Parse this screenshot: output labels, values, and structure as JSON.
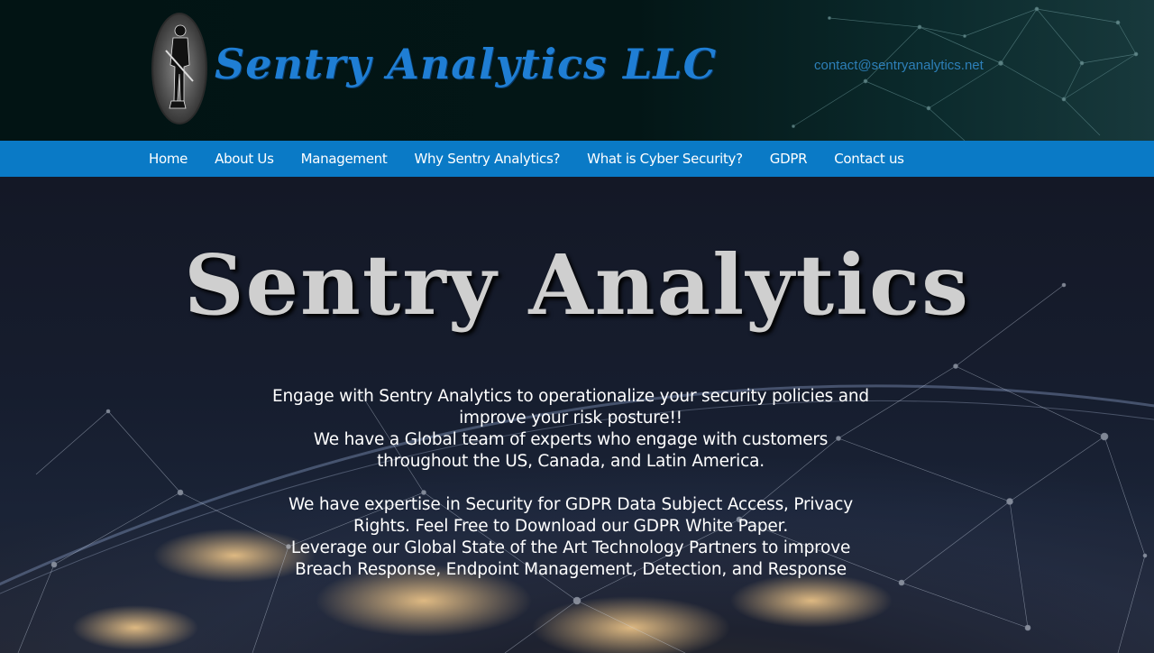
{
  "header": {
    "brand_name": "Sentry Analytics LLC",
    "contact_email": "contact@sentryanalytics.net"
  },
  "nav": {
    "items": [
      {
        "label": "Home"
      },
      {
        "label": "About Us"
      },
      {
        "label": "Management"
      },
      {
        "label": "Why Sentry Analytics?"
      },
      {
        "label": "What is Cyber Security?"
      },
      {
        "label": "GDPR"
      },
      {
        "label": "Contact us"
      }
    ]
  },
  "hero": {
    "title": "Sentry Analytics",
    "lines": [
      "Engage with Sentry Analytics to operationalize your security policies and",
      "improve your risk posture!!",
      "We have a Global team of experts who engage with customers",
      "throughout the US, Canada, and Latin America.",
      "We have expertise in Security for GDPR Data Subject Access, Privacy",
      "Rights. Feel Free to Download our GDPR White Paper.",
      "Leverage our Global State of the Art Technology Partners to improve",
      "Breach Response, Endpoint Management,  Detection, and Response"
    ]
  },
  "colors": {
    "brand": "#1f7ed4",
    "nav_bar": "#0a7ac6",
    "header_bg": "#021414",
    "hero_title": "#cfcfcf",
    "hero_text": "#ffffff",
    "contact_link": "#2d7fb8"
  },
  "icons": {
    "logo": "minuteman-logo-icon"
  }
}
